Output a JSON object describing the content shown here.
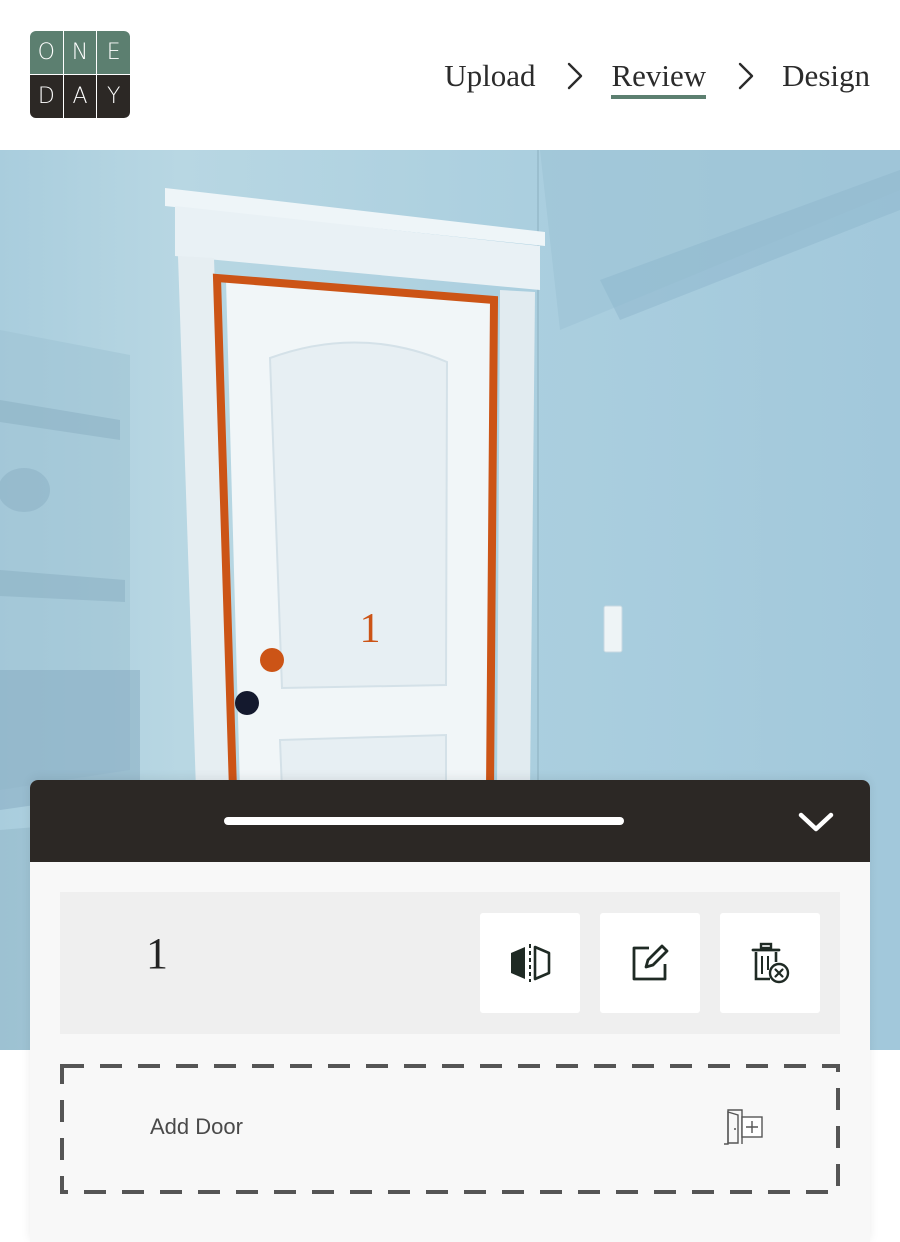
{
  "logo": {
    "top": [
      "O",
      "N",
      "E"
    ],
    "bottom": [
      "D",
      "A",
      "Y"
    ]
  },
  "steps": [
    {
      "label": "Upload",
      "active": false
    },
    {
      "label": "Review",
      "active": true
    },
    {
      "label": "Design",
      "active": false
    }
  ],
  "photo": {
    "door_label": "1"
  },
  "sheet": {
    "door": {
      "number": "1"
    },
    "tools": [
      "flip-icon",
      "edit-icon",
      "delete-icon"
    ],
    "add_door_label": "Add Door"
  },
  "colors": {
    "brand_green": "#5c7f70",
    "dark": "#2c2825",
    "outline": "#cc5416"
  }
}
